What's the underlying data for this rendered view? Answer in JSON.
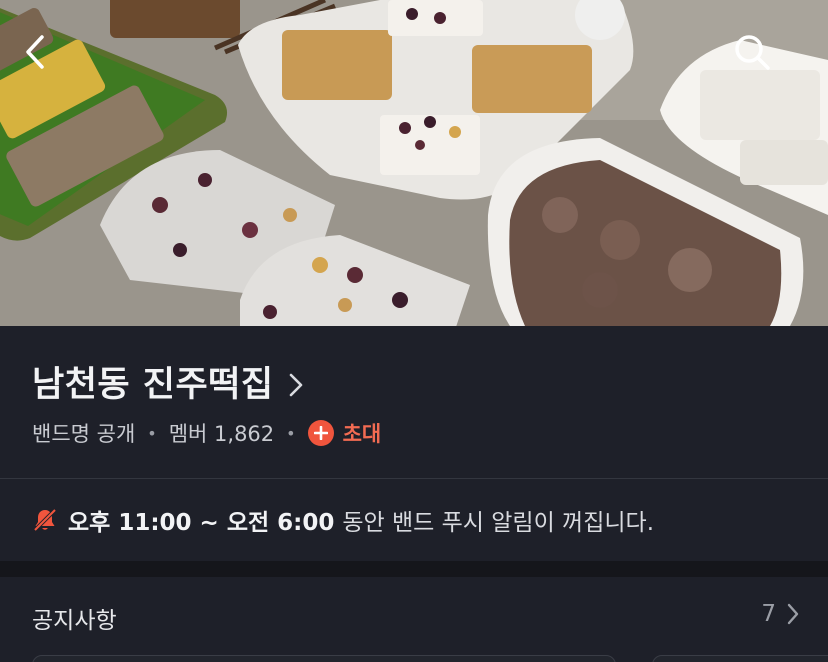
{
  "cover": {
    "photo_description_icon": "rice-cake-photo"
  },
  "nav": {
    "back_icon": "chevron-left-icon",
    "search_icon": "search-icon"
  },
  "band": {
    "name": "남천동 진주떡집",
    "visibility": "밴드명 공개",
    "members_label": "멤버 1,862",
    "invite_label": "초대"
  },
  "push_notice": {
    "icon": "bell-off-icon",
    "time_range": "오후 11:00 ~ 오전 6:00",
    "message": "동안 밴드 푸시 알림이 꺼집니다."
  },
  "notices": {
    "title": "공지사항",
    "count": "7"
  },
  "colors": {
    "background": "#1e2029",
    "accent": "#f26b52",
    "invite_badge": "#f0553d"
  }
}
